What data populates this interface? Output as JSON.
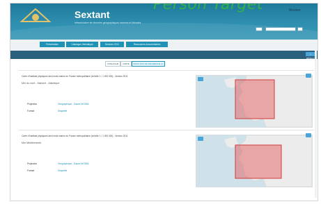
{
  "overlay_text": "Person Target",
  "app": {
    "title": "Sextant",
    "subtitle": "Infrastructure de données géographiques marines et littorales",
    "brand": "Ifremer"
  },
  "colors": {
    "header": "#1f7a9a",
    "nav_button": "#1f93b6",
    "band": "#2a5f7d",
    "map_sea": "#cfe2ea",
    "map_land": "#ececec",
    "highlight": "#e55353"
  },
  "header_controls": {
    "language_value": "",
    "search_placeholder": ""
  },
  "nav": {
    "items": [
      {
        "label": "Présentation"
      },
      {
        "label": "Catalogue thématique"
      },
      {
        "label": "Services OGC"
      },
      {
        "label": "Ressources documentaires"
      }
    ]
  },
  "band": {
    "right_button": "+ RÉSEAU"
  },
  "tabs": [
    {
      "label": "CATALOGUE"
    },
    {
      "label": "CARTE"
    },
    {
      "label": "RÉSULTATS DE RECHERCHE (2)"
    }
  ],
  "results": [
    {
      "title": "Carte d'habitats physiques des fonds marins en France métropolitaine (échelle 1 / 1 000 000) - Version 2011",
      "subtitle": "Mer du nord - Manche - Atlantique",
      "projection_label": "Projection",
      "projection_value": "Géographique - Datum WGS84",
      "format_label": "Format",
      "format_value": "Shapefile"
    },
    {
      "title": "Carte d'habitats physiques des fonds marins en France métropolitaine (échelle 1 / 1 000 000) - Version 2011",
      "subtitle": "Mer Méditerranée",
      "projection_label": "Projection",
      "projection_value": "Géographique - Datum WGS84",
      "format_label": "Format",
      "format_value": "Shapefile"
    }
  ]
}
